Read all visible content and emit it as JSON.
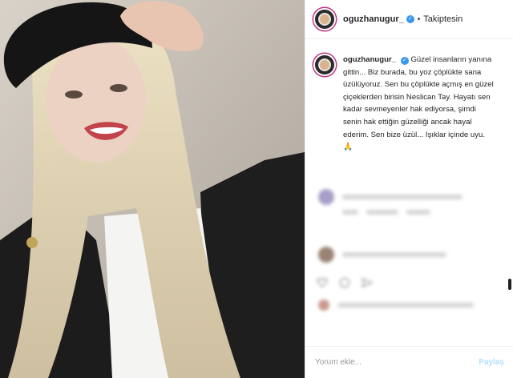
{
  "post": {
    "username": "oguzhanugur_",
    "follow_status": "Takiptesin",
    "separator": "•",
    "verified_glyph": "✓"
  },
  "caption": {
    "text": "Güzel insanların yanına gittin... Biz burada, bu yoz çöplükte sana üzülüyoruz. Sen bu çöplükte açmış en güzel çiçeklerden birisin Neslican Tay. Hayatı sen kadar sevmeyenler hak ediyorsa, şimdi senin hak ettiğin güzelliği ancak hayal ederim. Sen bize üzül... Işıklar içinde uyu. 🙏"
  },
  "comment_box": {
    "placeholder": "Yorum ekle...",
    "post_label": "Paylaş"
  },
  "icons": [
    "verified-badge-icon",
    "heart-icon",
    "comment-icon",
    "share-icon"
  ],
  "colors": {
    "verified": "#3897f0",
    "story_ring": "#c13584",
    "post_button": "#b2dffc"
  }
}
